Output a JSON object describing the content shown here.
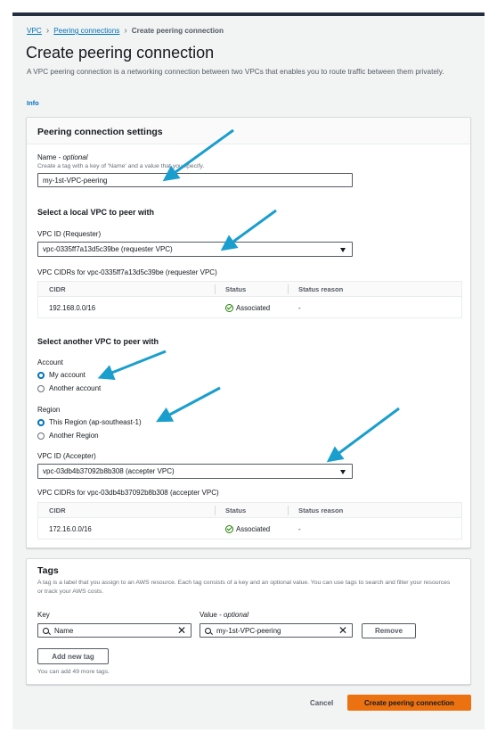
{
  "breadcrumb": {
    "vpc": "VPC",
    "peering": "Peering connections",
    "current": "Create peering connection"
  },
  "page": {
    "title": "Create peering connection",
    "description": "A VPC peering connection is a networking connection between two VPCs that enables you to route traffic between them privately.",
    "info": "Info"
  },
  "settings": {
    "title": "Peering connection settings",
    "name_label": "Name - ",
    "name_optional": "optional",
    "name_hint": "Create a tag with a key of 'Name' and a value that you specify.",
    "name_value": "my-1st-VPC-peering",
    "local_heading": "Select a local VPC to peer with",
    "requester_label": "VPC ID (Requester)",
    "requester_value": "vpc-0335ff7a13d5c39be (requester VPC)",
    "requester_cidrs_label": "VPC CIDRs for vpc-0335ff7a13d5c39be (requester VPC)",
    "table_headers": {
      "cidr": "CIDR",
      "status": "Status",
      "reason": "Status reason"
    },
    "requester_row": {
      "cidr": "192.168.0.0/16",
      "status": "Associated",
      "reason": "-"
    },
    "another_heading": "Select another VPC to peer with",
    "account_label": "Account",
    "account_options": [
      "My account",
      "Another account"
    ],
    "account_selected": "My account",
    "region_label": "Region",
    "region_options": [
      "This Region (ap-southeast-1)",
      "Another Region"
    ],
    "region_selected": "This Region (ap-southeast-1)",
    "accepter_label": "VPC ID (Accepter)",
    "accepter_value": "vpc-03db4b37092b8b308 (accepter VPC)",
    "accepter_cidrs_label": "VPC CIDRs for vpc-03db4b37092b8b308 (accepter VPC)",
    "accepter_row": {
      "cidr": "172.16.0.0/16",
      "status": "Associated",
      "reason": "-"
    }
  },
  "tags": {
    "title": "Tags",
    "description": "A tag is a label that you assign to an AWS resource. Each tag consists of a key and an optional value. You can use tags to search and filter your resources or track your AWS costs.",
    "key_label": "Key",
    "value_label": "Value - ",
    "value_optional": "optional",
    "key_value": "Name",
    "value_value": "my-1st-VPC-peering",
    "remove": "Remove",
    "add_new": "Add new tag",
    "remaining": "You can add 49 more tags."
  },
  "footer": {
    "cancel": "Cancel",
    "create": "Create peering connection"
  },
  "colors": {
    "primary": "#ec7211",
    "link": "#0073bb",
    "success": "#1d8102",
    "annotation_arrow": "#1a9ecd"
  }
}
